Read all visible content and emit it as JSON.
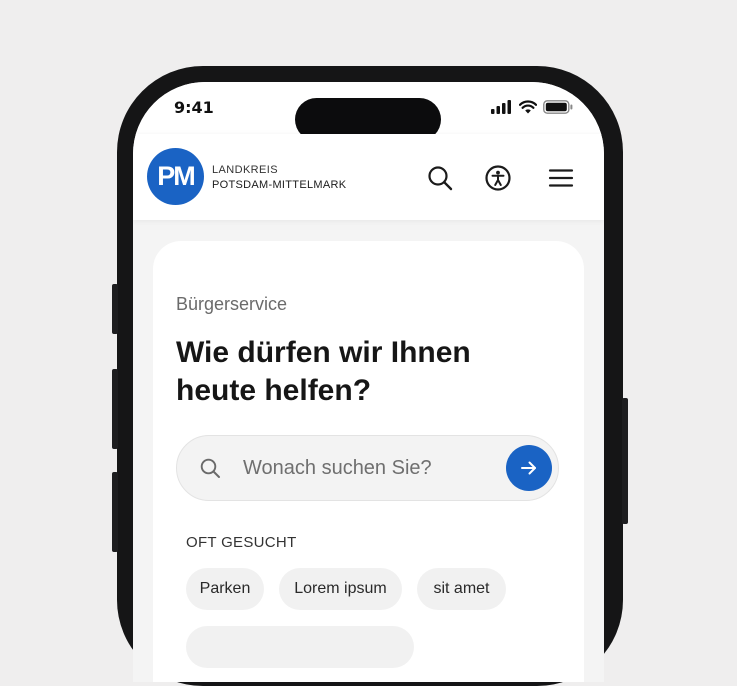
{
  "status_bar": {
    "time": "9:41"
  },
  "header": {
    "logo_initials": "PM",
    "logo_line1": "LANDKREIS",
    "logo_line2": "POTSDAM-MITTELMARK",
    "icons": [
      "search-icon",
      "accessibility-icon",
      "menu-icon"
    ]
  },
  "hero": {
    "eyebrow": "Bürgerservice",
    "headline_line1": "Wie dürfen wir Ihnen",
    "headline_line2": "heute helfen?"
  },
  "search": {
    "placeholder": "Wonach suchen Sie?",
    "value": ""
  },
  "frequent": {
    "label": "OFT GESUCHT",
    "chips": [
      "Parken",
      "Lorem ipsum",
      "sit amet"
    ]
  },
  "colors": {
    "brand_blue": "#1a63c4",
    "background": "#efeeee",
    "card": "#ffffff",
    "chip": "#f1f1f1"
  }
}
